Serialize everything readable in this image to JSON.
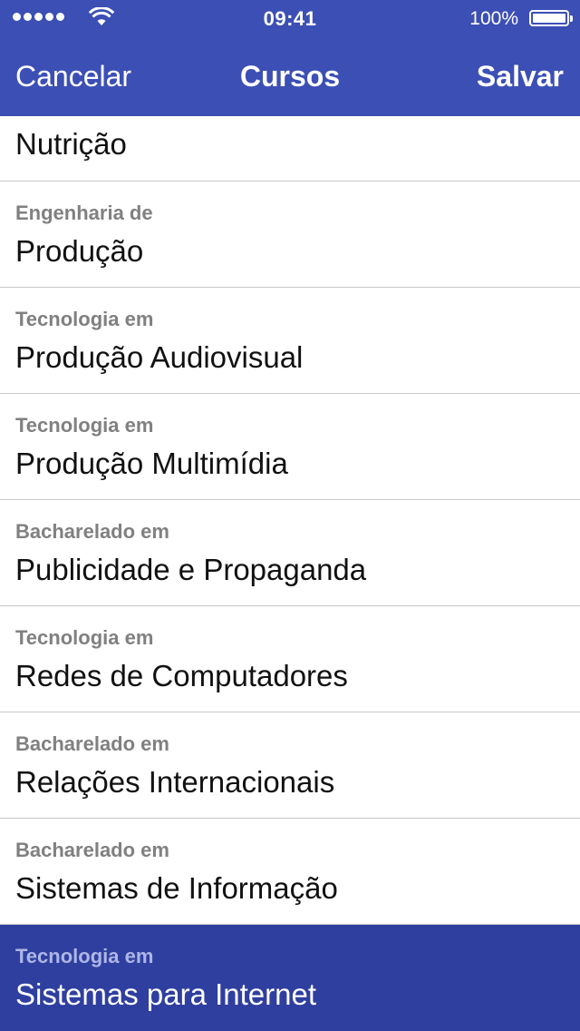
{
  "status_bar": {
    "time": "09:41",
    "battery_percent": "100%",
    "signal_bars": 5,
    "wifi_icon": "wifi-icon"
  },
  "nav": {
    "cancel_label": "Cancelar",
    "title": "Cursos",
    "save_label": "Salvar"
  },
  "colors": {
    "header_bg": "#3c4fb5",
    "selected_row_bg": "#2f3f9f",
    "secondary_text": "#808080"
  },
  "courses": [
    {
      "prefix": "",
      "name": "Nutrição",
      "selected": false
    },
    {
      "prefix": "Engenharia de",
      "name": "Produção",
      "selected": false
    },
    {
      "prefix": "Tecnologia em",
      "name": "Produção Audiovisual",
      "selected": false
    },
    {
      "prefix": "Tecnologia em",
      "name": "Produção Multimídia",
      "selected": false
    },
    {
      "prefix": "Bacharelado em",
      "name": "Publicidade e Propaganda",
      "selected": false
    },
    {
      "prefix": "Tecnologia em",
      "name": "Redes de Computadores",
      "selected": false
    },
    {
      "prefix": "Bacharelado em",
      "name": "Relações Internacionais",
      "selected": false
    },
    {
      "prefix": "Bacharelado em",
      "name": "Sistemas de Informação",
      "selected": false
    },
    {
      "prefix": "Tecnologia em",
      "name": "Sistemas para Internet",
      "selected": true
    }
  ]
}
